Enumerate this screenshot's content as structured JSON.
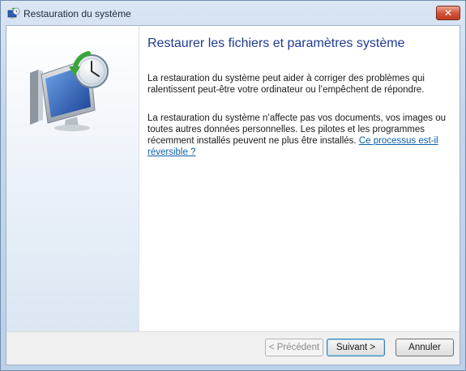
{
  "window": {
    "title": "Restauration du système",
    "close_label": "✕"
  },
  "main": {
    "heading": "Restaurer les fichiers et paramètres système",
    "paragraph1": "La restauration du système peut aider à corriger des problèmes qui ralentissent peut-être votre ordinateur ou l’empêchent de répondre.",
    "paragraph2": "La restauration du système n’affecte pas vos documents, vos images ou toutes autres données personnelles. Les pilotes et les programmes récemment installés peuvent ne plus être installés.",
    "link_text": "Ce processus est-il réversible ?"
  },
  "footer": {
    "prev_label": "< Précédent",
    "next_label": "Suivant >",
    "cancel_label": "Annuler"
  },
  "icons": {
    "title_icon": "system-restore-icon",
    "hero_icon": "computer-clock-restore-icon"
  },
  "colors": {
    "heading": "#1f3a93",
    "link": "#0a5ea8",
    "close_button": "#c23a22"
  }
}
